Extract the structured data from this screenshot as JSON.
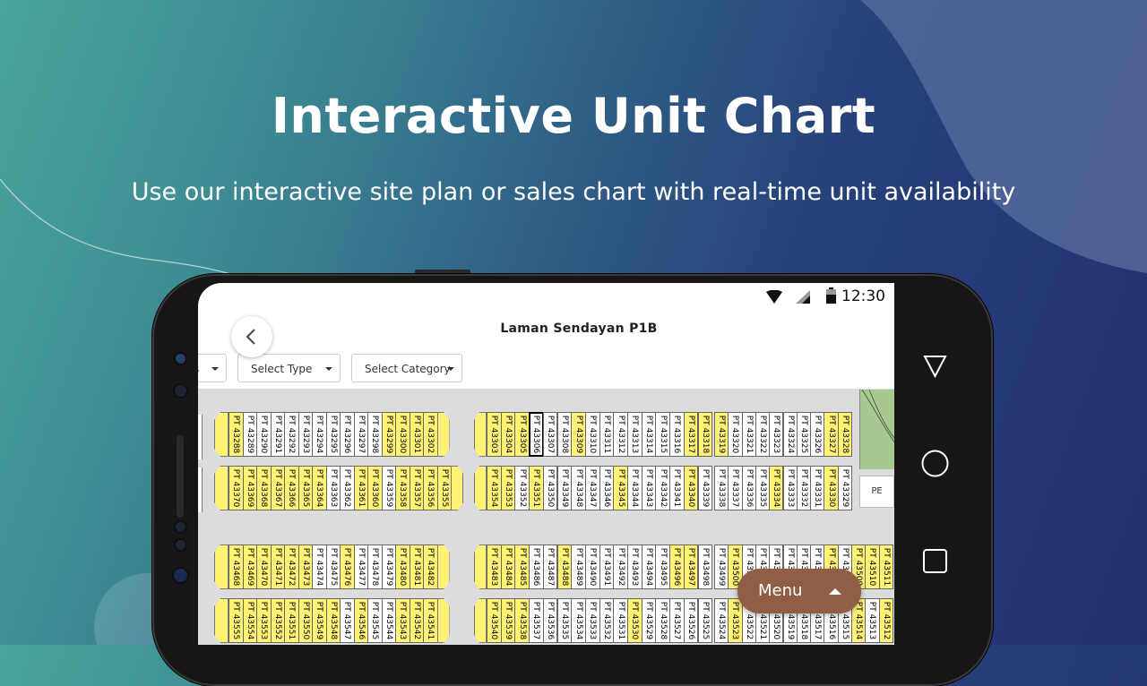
{
  "hero": {
    "title": "Interactive Unit Chart",
    "subtitle": "Use our interactive site plan or sales chart with real-time unit availability"
  },
  "status_bar": {
    "time": "12:30"
  },
  "app": {
    "title": "Laman Sendayan P1B",
    "filters": [
      {
        "label": "s"
      },
      {
        "label": "Select Type"
      },
      {
        "label": "Select Category"
      }
    ],
    "menu_label": "Menu"
  },
  "legend_colors": {
    "available": "#fff275",
    "other": "#ffffff"
  },
  "map_labels": {
    "pe": "PE"
  },
  "unit_rows": [
    {
      "name": "row-1-left",
      "units": [
        {
          "l": "PT 43288",
          "y": 1
        },
        {
          "l": "PT 43289",
          "y": 0
        },
        {
          "l": "PT 43290",
          "y": 0
        },
        {
          "l": "PT 43291",
          "y": 0
        },
        {
          "l": "PT 43292",
          "y": 0
        },
        {
          "l": "PT 43293",
          "y": 0
        },
        {
          "l": "PT 43294",
          "y": 0
        },
        {
          "l": "PT 43295",
          "y": 0
        },
        {
          "l": "PT 43296",
          "y": 0
        },
        {
          "l": "PT 43297",
          "y": 0
        },
        {
          "l": "PT 43298",
          "y": 0
        },
        {
          "l": "PT 43299",
          "y": 1
        },
        {
          "l": "PT 43300",
          "y": 1
        },
        {
          "l": "PT 43301",
          "y": 1
        },
        {
          "l": "PT 43302",
          "y": 1
        }
      ]
    },
    {
      "name": "row-1-mid",
      "units": [
        {
          "l": "PT 43303",
          "y": 1
        },
        {
          "l": "PT 43304",
          "y": 1
        },
        {
          "l": "PT 43305",
          "y": 1
        },
        {
          "l": "PT 43306",
          "y": 0,
          "s": 1
        },
        {
          "l": "PT 43307",
          "y": 0
        },
        {
          "l": "PT 43308",
          "y": 0
        },
        {
          "l": "PT 43309",
          "y": 1
        },
        {
          "l": "PT 43310",
          "y": 0
        },
        {
          "l": "PT 43311",
          "y": 0
        },
        {
          "l": "PT 43312",
          "y": 0
        },
        {
          "l": "PT 43313",
          "y": 0
        },
        {
          "l": "PT 43314",
          "y": 0
        },
        {
          "l": "PT 43315",
          "y": 0
        },
        {
          "l": "PT 43316",
          "y": 0
        },
        {
          "l": "PT 43317",
          "y": 1
        },
        {
          "l": "PT 43318",
          "y": 1
        }
      ]
    },
    {
      "name": "row-1-right",
      "units": [
        {
          "l": "PT 43319",
          "y": 1
        },
        {
          "l": "PT 43320",
          "y": 0
        },
        {
          "l": "PT 43321",
          "y": 0
        },
        {
          "l": "PT 43322",
          "y": 0
        },
        {
          "l": "PT 43323",
          "y": 0
        },
        {
          "l": "PT 43324",
          "y": 0
        },
        {
          "l": "PT 43325",
          "y": 0
        },
        {
          "l": "PT 43326",
          "y": 0
        },
        {
          "l": "PT 43327",
          "y": 1
        },
        {
          "l": "PT 43328",
          "y": 1
        }
      ]
    },
    {
      "name": "row-2-left",
      "units": [
        {
          "l": "PT 43370",
          "y": 1
        },
        {
          "l": "PT 43369",
          "y": 1
        },
        {
          "l": "PT 43368",
          "y": 1
        },
        {
          "l": "PT 43367",
          "y": 1
        },
        {
          "l": "PT 43366",
          "y": 1
        },
        {
          "l": "PT 43365",
          "y": 1
        },
        {
          "l": "PT 43364",
          "y": 1
        },
        {
          "l": "PT 43363",
          "y": 0
        },
        {
          "l": "PT 43362",
          "y": 0
        },
        {
          "l": "PT 43361",
          "y": 1
        },
        {
          "l": "PT 43360",
          "y": 1
        },
        {
          "l": "PT 43359",
          "y": 0
        },
        {
          "l": "PT 43358",
          "y": 1
        },
        {
          "l": "PT 43357",
          "y": 1
        },
        {
          "l": "PT 43356",
          "y": 1
        },
        {
          "l": "PT 43355",
          "y": 1
        }
      ]
    },
    {
      "name": "row-2-mid",
      "units": [
        {
          "l": "PT 43354",
          "y": 1
        },
        {
          "l": "PT 43353",
          "y": 1
        },
        {
          "l": "PT 43352",
          "y": 0
        },
        {
          "l": "PT 43351",
          "y": 1
        },
        {
          "l": "PT 43350",
          "y": 0
        },
        {
          "l": "PT 43349",
          "y": 0
        },
        {
          "l": "PT 43348",
          "y": 0
        },
        {
          "l": "PT 43347",
          "y": 0
        },
        {
          "l": "PT 43346",
          "y": 0
        },
        {
          "l": "PT 43345",
          "y": 1
        },
        {
          "l": "PT 43344",
          "y": 0
        },
        {
          "l": "PT 43343",
          "y": 0
        },
        {
          "l": "PT 43342",
          "y": 0
        },
        {
          "l": "PT 43341",
          "y": 0
        },
        {
          "l": "PT 43340",
          "y": 1
        },
        {
          "l": "PT 43339",
          "y": 0
        }
      ]
    },
    {
      "name": "row-2-right",
      "units": [
        {
          "l": "PT 43338",
          "y": 0
        },
        {
          "l": "PT 43337",
          "y": 0
        },
        {
          "l": "PT 43336",
          "y": 0
        },
        {
          "l": "PT 43335",
          "y": 0
        },
        {
          "l": "PT 43334",
          "y": 1
        },
        {
          "l": "PT 43333",
          "y": 0
        },
        {
          "l": "PT 43332",
          "y": 0
        },
        {
          "l": "PT 43331",
          "y": 0
        },
        {
          "l": "PT 43330",
          "y": 1
        },
        {
          "l": "PT 43329",
          "y": 0
        }
      ]
    },
    {
      "name": "row-3-left",
      "units": [
        {
          "l": "PT 43468",
          "y": 1
        },
        {
          "l": "PT 43469",
          "y": 1
        },
        {
          "l": "PT 43470",
          "y": 1
        },
        {
          "l": "PT 43471",
          "y": 1
        },
        {
          "l": "PT 43472",
          "y": 1
        },
        {
          "l": "PT 43473",
          "y": 1
        },
        {
          "l": "PT 43474",
          "y": 0
        },
        {
          "l": "PT 43475",
          "y": 0
        },
        {
          "l": "PT 43476",
          "y": 1
        },
        {
          "l": "PT 43477",
          "y": 0
        },
        {
          "l": "PT 43478",
          "y": 0
        },
        {
          "l": "PT 43479",
          "y": 0
        },
        {
          "l": "PT 43480",
          "y": 1
        },
        {
          "l": "PT 43481",
          "y": 1
        },
        {
          "l": "PT 43482",
          "y": 1
        }
      ]
    },
    {
      "name": "row-3-mid",
      "units": [
        {
          "l": "PT 43483",
          "y": 1
        },
        {
          "l": "PT 43484",
          "y": 1
        },
        {
          "l": "PT 43485",
          "y": 1
        },
        {
          "l": "PT 43486",
          "y": 0
        },
        {
          "l": "PT 43487",
          "y": 0
        },
        {
          "l": "PT 43488",
          "y": 1
        },
        {
          "l": "PT 43489",
          "y": 0
        },
        {
          "l": "PT 43490",
          "y": 0
        },
        {
          "l": "PT 43491",
          "y": 0
        },
        {
          "l": "PT 43492",
          "y": 0
        },
        {
          "l": "PT 43493",
          "y": 0
        },
        {
          "l": "PT 43494",
          "y": 0
        },
        {
          "l": "PT 43495",
          "y": 0
        },
        {
          "l": "PT 43496",
          "y": 1
        },
        {
          "l": "PT 43497",
          "y": 1
        },
        {
          "l": "PT 43498",
          "y": 0
        }
      ]
    },
    {
      "name": "row-3-right",
      "units": [
        {
          "l": "PT 43499",
          "y": 0
        },
        {
          "l": "PT 43500",
          "y": 1
        },
        {
          "l": "PT 43501",
          "y": 0
        },
        {
          "l": "PT 43502",
          "y": 0
        },
        {
          "l": "PT 43503",
          "y": 0
        },
        {
          "l": "PT 43504",
          "y": 0
        },
        {
          "l": "PT 43505",
          "y": 0
        },
        {
          "l": "PT 43506",
          "y": 0
        },
        {
          "l": "PT 43507",
          "y": 1
        },
        {
          "l": "PT 43508",
          "y": 0
        },
        {
          "l": "PT 43509",
          "y": 1
        },
        {
          "l": "PT 43510",
          "y": 1
        },
        {
          "l": "PT 43511",
          "y": 1
        }
      ]
    },
    {
      "name": "row-4-left",
      "units": [
        {
          "l": "PT 43555",
          "y": 1
        },
        {
          "l": "PT 43554",
          "y": 1
        },
        {
          "l": "PT 43553",
          "y": 1
        },
        {
          "l": "PT 43552",
          "y": 1
        },
        {
          "l": "PT 43551",
          "y": 1
        },
        {
          "l": "PT 43550",
          "y": 1
        },
        {
          "l": "PT 43549",
          "y": 1
        },
        {
          "l": "PT 43548",
          "y": 1
        },
        {
          "l": "PT 43547",
          "y": 0
        },
        {
          "l": "PT 43546",
          "y": 1
        },
        {
          "l": "PT 43545",
          "y": 0
        },
        {
          "l": "PT 43544",
          "y": 0
        },
        {
          "l": "PT 43543",
          "y": 1
        },
        {
          "l": "PT 43542",
          "y": 1
        },
        {
          "l": "PT 43541",
          "y": 1
        }
      ]
    },
    {
      "name": "row-4-mid",
      "units": [
        {
          "l": "PT 43540",
          "y": 1
        },
        {
          "l": "PT 43539",
          "y": 1
        },
        {
          "l": "PT 43538",
          "y": 1
        },
        {
          "l": "PT 43537",
          "y": 0
        },
        {
          "l": "PT 43536",
          "y": 0
        },
        {
          "l": "PT 43535",
          "y": 0
        },
        {
          "l": "PT 43534",
          "y": 0
        },
        {
          "l": "PT 43533",
          "y": 0
        },
        {
          "l": "PT 43532",
          "y": 0
        },
        {
          "l": "PT 43531",
          "y": 0
        },
        {
          "l": "PT 43530",
          "y": 1
        },
        {
          "l": "PT 43529",
          "y": 0
        },
        {
          "l": "PT 43528",
          "y": 0
        },
        {
          "l": "PT 43527",
          "y": 0
        },
        {
          "l": "PT 43526",
          "y": 0
        },
        {
          "l": "PT 43525",
          "y": 0
        }
      ]
    },
    {
      "name": "row-4-right",
      "units": [
        {
          "l": "PT 43524",
          "y": 0
        },
        {
          "l": "PT 43523",
          "y": 1
        },
        {
          "l": "PT 43522",
          "y": 0
        },
        {
          "l": "PT 43521",
          "y": 0
        },
        {
          "l": "PT 43520",
          "y": 0
        },
        {
          "l": "PT 43519",
          "y": 0
        },
        {
          "l": "PT 43518",
          "y": 0
        },
        {
          "l": "PT 43517",
          "y": 0
        },
        {
          "l": "PT 43516",
          "y": 0
        },
        {
          "l": "PT 43515",
          "y": 0
        },
        {
          "l": "PT 43514",
          "y": 1
        },
        {
          "l": "PT 43513",
          "y": 0
        },
        {
          "l": "PT 43512",
          "y": 1
        }
      ]
    }
  ]
}
